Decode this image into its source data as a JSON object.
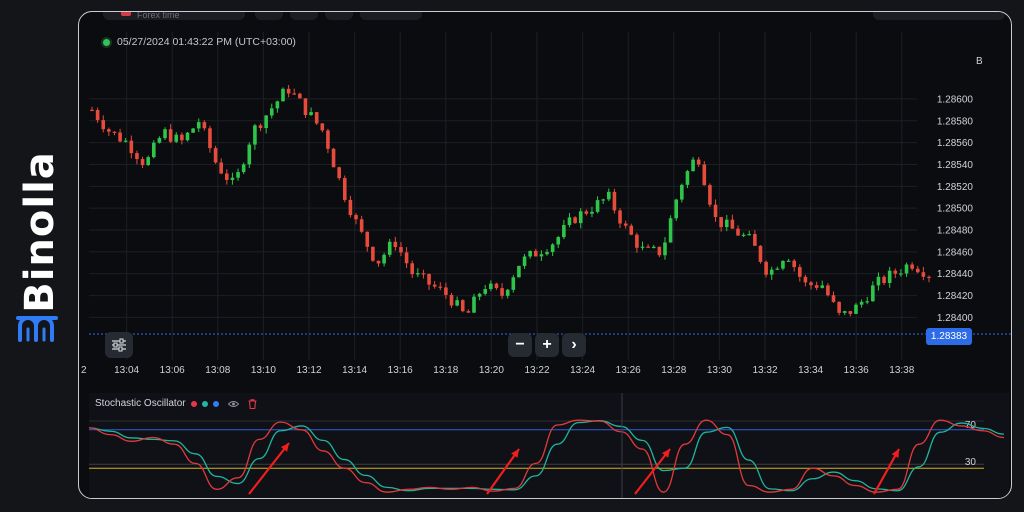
{
  "brand": {
    "name": "Binolla",
    "logo_icon": "binolla-logo-icon",
    "color": "#2f7cf6"
  },
  "toolbar": {
    "asset_label": "Forex time"
  },
  "chart": {
    "timestamp": "05/27/2024  01:43:22 PM (UTC+03:00)",
    "current_price": "1.28383",
    "price_axis_cap": "B",
    "price_ticks": [
      "1.28600",
      "1.28580",
      "1.28560",
      "1.28540",
      "1.28520",
      "1.28500",
      "1.28480",
      "1.28460",
      "1.28440",
      "1.28420",
      "1.28400"
    ],
    "time_ticks": [
      "2",
      "13:04",
      "13:06",
      "13:08",
      "13:10",
      "13:12",
      "13:14",
      "13:16",
      "13:18",
      "13:20",
      "13:22",
      "13:24",
      "13:26",
      "13:28",
      "13:30",
      "13:32",
      "13:34",
      "13:36",
      "13:38"
    ],
    "zoom_out": "−",
    "zoom_in": "+",
    "scroll_right": "›",
    "colors": {
      "up": "#2ec54a",
      "down": "#e64b3c",
      "price_tag": "#2e6be6"
    }
  },
  "indicator": {
    "name": "Stochastic Oscillator",
    "levels": [
      "70",
      "30"
    ],
    "dot_colors": [
      "#e6374a",
      "#26b3a5",
      "#2f7cf6"
    ],
    "line_colors": {
      "k": "#e03a3a",
      "d": "#1fb59f",
      "upper": "#2f5fd6",
      "lower": "#d4b21a"
    }
  },
  "chart_data": {
    "type": "candlestick",
    "x_range": [
      "13:02",
      "13:38"
    ],
    "y_range": [
      1.28383,
      1.2861
    ],
    "close_path": [
      1.2859,
      1.2857,
      1.2856,
      1.2854,
      1.2857,
      1.2856,
      1.2858,
      1.2854,
      1.2852,
      1.2857,
      1.2859,
      1.2861,
      1.2859,
      1.2857,
      1.2852,
      1.2848,
      1.2845,
      1.2847,
      1.2844,
      1.2843,
      1.2842,
      1.284,
      1.2843,
      1.2842,
      1.2845,
      1.2846,
      1.2847,
      1.2849,
      1.285,
      1.2851,
      1.2848,
      1.2846,
      1.2846,
      1.2852,
      1.2855,
      1.2849,
      1.2848,
      1.2847,
      1.2844,
      1.2846,
      1.2843,
      1.2843,
      1.284,
      1.2841,
      1.2843,
      1.2844,
      1.2845,
      1.2844
    ],
    "stochastic_k": [
      72,
      65,
      58,
      62,
      55,
      35,
      8,
      20,
      60,
      78,
      70,
      48,
      30,
      15,
      5,
      8,
      10,
      8,
      10,
      6,
      9,
      35,
      75,
      80,
      79,
      68,
      50,
      5,
      55,
      80,
      65,
      12,
      5,
      8,
      30,
      22,
      12,
      5,
      8,
      55,
      80,
      74,
      69,
      62
    ]
  }
}
